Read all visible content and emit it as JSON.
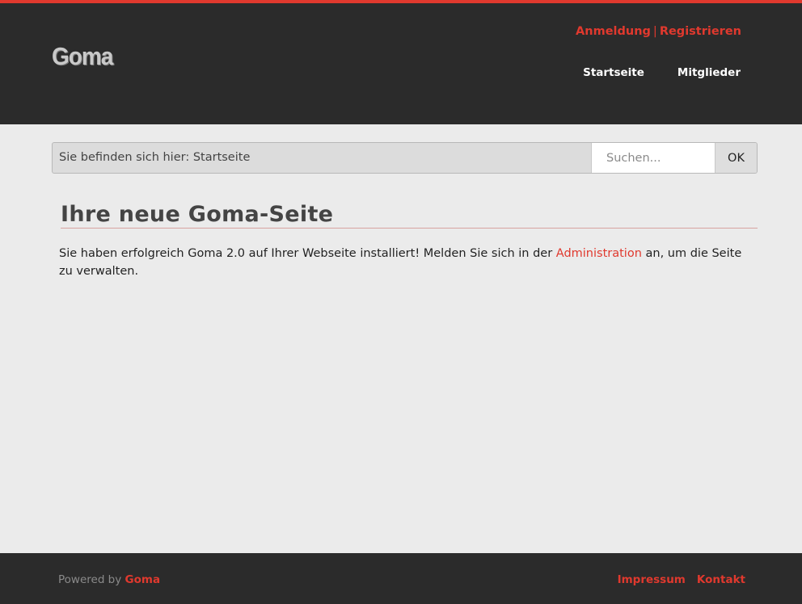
{
  "header": {
    "logo": "Goma",
    "login": "Anmeldung",
    "separator": "|",
    "register": "Registrieren",
    "nav": [
      "Startseite",
      "Mitglieder"
    ]
  },
  "breadcrumb": {
    "text": "Sie befinden sich hier: Startseite"
  },
  "search": {
    "placeholder": "Suchen...",
    "button": "OK"
  },
  "content": {
    "title": "Ihre neue Goma-Seite",
    "text_before": "Sie haben erfolgreich Goma 2.0 auf Ihrer Webseite installiert! Melden Sie sich in der ",
    "link": "Administration",
    "text_after": " an, um die Seite zu verwalten."
  },
  "footer": {
    "powered_prefix": "Powered by ",
    "powered_link": "Goma",
    "links": [
      "Impressum",
      "Kontakt"
    ]
  },
  "colors": {
    "accent": "#e0392e",
    "header_bg": "#2b2b2b",
    "page_bg": "#ebebeb"
  }
}
